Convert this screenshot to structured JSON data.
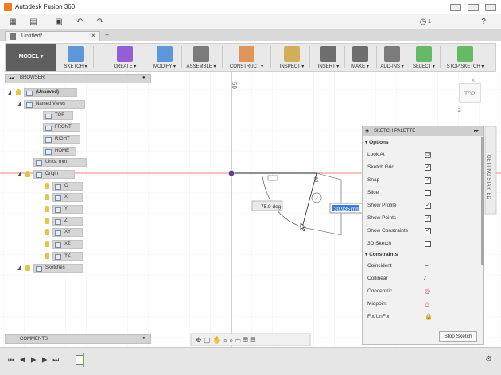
{
  "window": {
    "title": "Autodesk Fusion 360",
    "job_count": "1"
  },
  "document_tab": {
    "label": "Untitled*"
  },
  "ribbon": {
    "workspace": "MODEL",
    "groups": [
      {
        "label": "SKETCH",
        "color": "#2e7bd1"
      },
      {
        "label": "CREATE",
        "color": "#7b2ecf"
      },
      {
        "label": "MODIFY",
        "color": "#2e7bd1"
      },
      {
        "label": "ASSEMBLE",
        "color": "#555555"
      },
      {
        "label": "CONSTRUCT",
        "color": "#d97a2c"
      },
      {
        "label": "INSPECT",
        "color": "#c89a2a"
      },
      {
        "label": "INSERT",
        "color": "#444444"
      },
      {
        "label": "MAKE",
        "color": "#444444"
      },
      {
        "label": "ADD-INS",
        "color": "#555555"
      },
      {
        "label": "SELECT",
        "color": "#3aa83a"
      },
      {
        "label": "STOP SKETCH",
        "color": "#3aa83a"
      }
    ]
  },
  "browser": {
    "title": "BROWSER",
    "root": "(Unsaved)",
    "named_views": "Named Views",
    "views": [
      "TOP",
      "FRONT",
      "RIGHT",
      "HOME"
    ],
    "units": "Units: mm",
    "origin": "Origin",
    "origin_items": [
      "O",
      "X",
      "Y",
      "Z",
      "XY",
      "XZ",
      "YZ"
    ],
    "sketches": "Sketches"
  },
  "comments": {
    "title": "COMMENTS"
  },
  "viewcube": {
    "face": "TOP",
    "axis_x": "X",
    "axis_z": "Z"
  },
  "canvas": {
    "ruler_value": "50",
    "angle_input": "75.9 deg",
    "length_input": "30.935 mm",
    "dim_value": "50"
  },
  "sketch_palette": {
    "title": "SKETCH PALETTE",
    "options_header": "Options",
    "options": [
      {
        "label": "Look At",
        "type": "icon"
      },
      {
        "label": "Sketch Grid",
        "checked": true
      },
      {
        "label": "Snap",
        "checked": true
      },
      {
        "label": "Slice",
        "checked": false
      },
      {
        "label": "Show Profile",
        "checked": true
      },
      {
        "label": "Show Points",
        "checked": true
      },
      {
        "label": "Show Constraints",
        "checked": true
      },
      {
        "label": "3D Sketch",
        "checked": false
      }
    ],
    "constraints_header": "Constraints",
    "constraints": [
      "Coincident",
      "Collinear",
      "Concentric",
      "Midpoint",
      "Fix/UnFix"
    ],
    "stop_button": "Stop Sketch"
  },
  "getting_started": "GETTING STARTED"
}
